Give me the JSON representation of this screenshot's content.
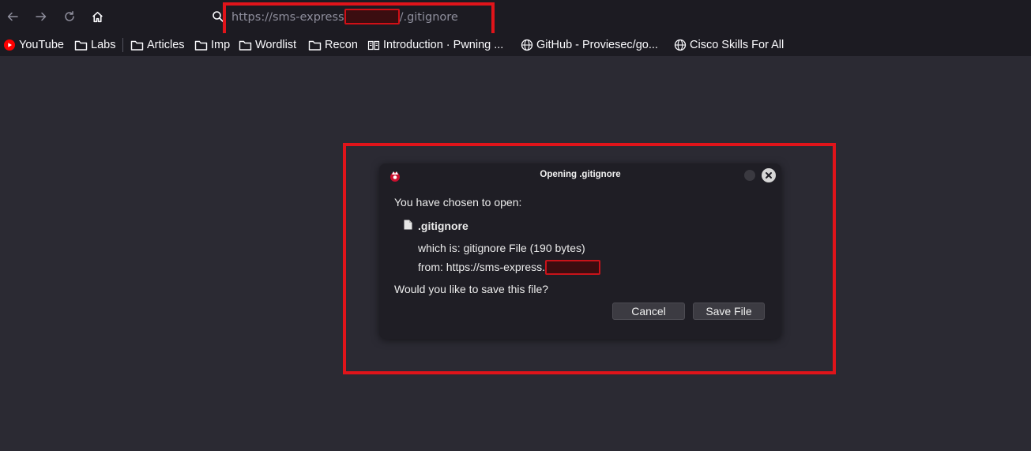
{
  "browser": {
    "nav": {
      "back_icon": "arrow-left-icon",
      "forward_icon": "arrow-right-icon",
      "reload_icon": "reload-icon",
      "home_icon": "home-icon"
    },
    "url": {
      "prefix": "https://sms-express",
      "suffix": "/.gitignore",
      "redacted": true
    }
  },
  "bookmarks": [
    {
      "label": "YouTube",
      "icon": "youtube-icon"
    },
    {
      "label": "Labs",
      "icon": "folder-icon"
    },
    {
      "label": "Articles",
      "icon": "folder-icon"
    },
    {
      "label": "Imp",
      "icon": "folder-icon"
    },
    {
      "label": "Wordlist",
      "icon": "folder-icon"
    },
    {
      "label": "Recon",
      "icon": "folder-icon"
    },
    {
      "label": "Introduction · Pwning ...",
      "icon": "book-icon"
    },
    {
      "label": "GitHub - Proviesec/go...",
      "icon": "globe-icon"
    },
    {
      "label": "Cisco Skills For All",
      "icon": "globe-icon"
    }
  ],
  "dialog": {
    "title": "Opening .gitignore",
    "intro": "You have chosen to open:",
    "filename": ".gitignore",
    "which_is": "which is: gitignore File (190 bytes)",
    "from": "from: https://sms-express.",
    "question": "Would you like to save this file?",
    "cancel_label": "Cancel",
    "save_label": "Save File"
  },
  "colors": {
    "annotation_red": "#e0141a",
    "page_background": "#2b2a33",
    "toolbar_background": "#1c1b22"
  }
}
